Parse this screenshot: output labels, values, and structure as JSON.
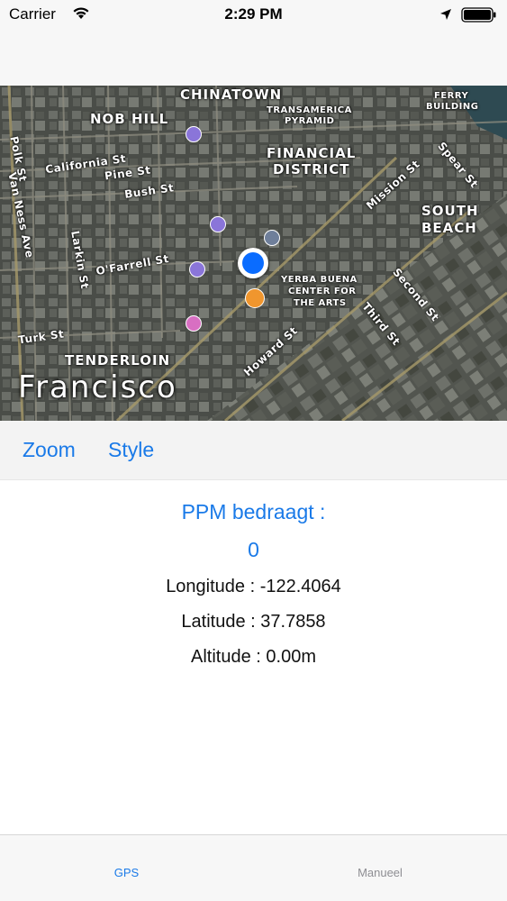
{
  "status_bar": {
    "carrier": "Carrier",
    "time": "2:29 PM"
  },
  "map": {
    "city_label": "Francisco",
    "districts": [
      "CHINATOWN",
      "NOB HILL",
      "FINANCIAL",
      "DISTRICT",
      "SOUTH",
      "BEACH",
      "TENDERLOIN"
    ],
    "landmarks": [
      "TRANSAMERICA",
      "PYRAMID",
      "FERRY",
      "BUILDING",
      "YERBA BUENA",
      "CENTER FOR",
      "THE ARTS"
    ],
    "streets": [
      "Polk St",
      "Van Ness Ave",
      "California St",
      "Pine St",
      "Bush St",
      "Larkin St",
      "O'Farrell St",
      "Turk St",
      "Mission St",
      "Spear St",
      "Second St",
      "Third St",
      "Howard St"
    ]
  },
  "toolbar": {
    "zoom_label": "Zoom",
    "style_label": "Style"
  },
  "info": {
    "ppm_title": "PPM bedraagt :",
    "ppm_value": "0",
    "longitude": "Longitude : -122.4064",
    "latitude": "Latitude : 37.7858",
    "altitude": "Altitude : 0.00m"
  },
  "tab_bar": {
    "tabs": [
      {
        "label": "GPS",
        "selected": true
      },
      {
        "label": "Manueel",
        "selected": false
      }
    ]
  },
  "colors": {
    "accent": "#1a7ae8",
    "user_location": "#0a6cff",
    "tab_inactive": "#8e8e93"
  },
  "icons": [
    "wifi-icon",
    "location-arrow-icon",
    "battery-icon",
    "user-location-icon"
  ]
}
